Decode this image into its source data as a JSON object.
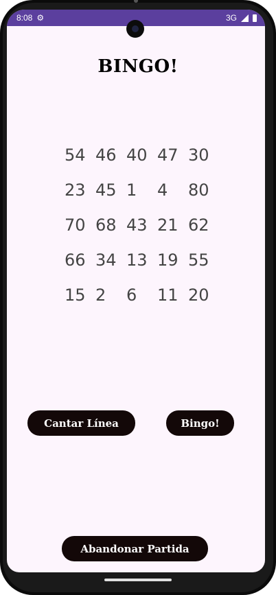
{
  "status_bar": {
    "time": "8:08",
    "network": "3G",
    "settings_icon": "gear-icon",
    "signal_icon": "signal-icon",
    "battery_icon": "battery-icon"
  },
  "app": {
    "title": "BINGO!"
  },
  "card": {
    "rows": [
      [
        "54",
        "46",
        "40",
        "47",
        "30"
      ],
      [
        "23",
        "45",
        "1",
        "4",
        "80"
      ],
      [
        "70",
        "68",
        "43",
        "21",
        "62"
      ],
      [
        "66",
        "34",
        "13",
        "19",
        "55"
      ],
      [
        "15",
        "2",
        "6",
        "11",
        "20"
      ]
    ]
  },
  "actions": {
    "cantar_linea": "Cantar Línea",
    "bingo": "Bingo!",
    "abandonar": "Abandonar Partida"
  },
  "colors": {
    "status_bar": "#5b3f9e",
    "background": "#fdf5fd",
    "button": "#130808",
    "number": "#444444"
  }
}
